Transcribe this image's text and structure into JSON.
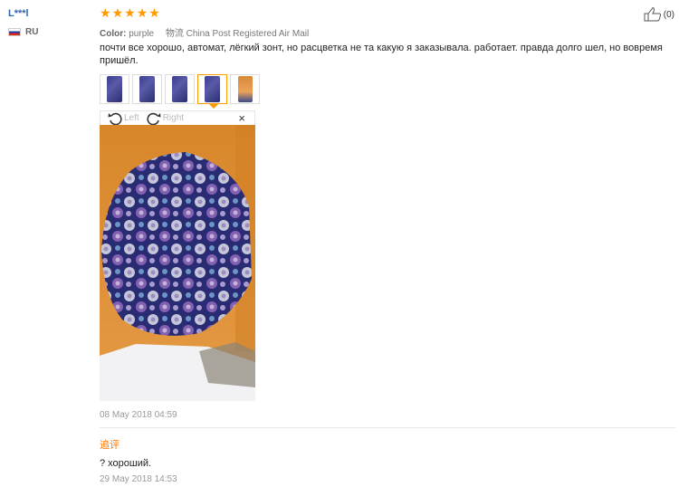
{
  "user": {
    "name": "L***l",
    "country": "RU"
  },
  "rating": {
    "stars": 5,
    "star_glyph": "★"
  },
  "helpful": {
    "count": "(0)"
  },
  "meta": {
    "color_label": "Color:",
    "color_value": "purple",
    "shipping_label": "物流",
    "shipping_value": "China Post Registered Air Mail"
  },
  "review": {
    "text": "почти все хорошо, автомат, лёгкий зонт, но расцветка не та какую я заказывала. работает. правда долго шел, но вовремя пришёл.",
    "thumbnail_count": 5,
    "active_thumbnail": 4,
    "viewer": {
      "left_label": "Left",
      "right_label": "Right",
      "close_label": "×"
    },
    "date": "08 May 2018 04:59"
  },
  "followup": {
    "label": "追评",
    "text": "? хороший.",
    "date": "29 May 2018 14:53"
  },
  "colors": {
    "accent": "#ff9a00",
    "followup": "#ff7300",
    "username": "#3366aa"
  }
}
